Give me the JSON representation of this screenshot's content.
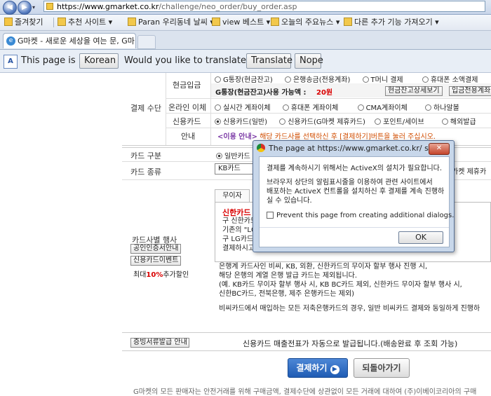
{
  "browser": {
    "url_host": "https://www.gmarket.co.kr",
    "url_path": "/challenge/neo_order/buy_order.asp",
    "favorites": [
      {
        "label": "즐겨찾기"
      },
      {
        "label": "추천 사이트 ▾"
      },
      {
        "label": "Paran 우리동네 날씨 ▾"
      },
      {
        "label": "view 베스트 ▾"
      },
      {
        "label": "오늘의 주요뉴스 ▾"
      },
      {
        "label": "다른 추가 기능 가져오기 ▾"
      }
    ],
    "tab_title": "G마켓 - 새로운 세상을 여는 문, G마켓",
    "translate": {
      "prefix": "This page is in",
      "language": "Korean",
      "question": "Would you like to translate it?",
      "translate_btn": "Translate",
      "nope_btn": "Nope"
    }
  },
  "payment": {
    "section_label": "결제 수단",
    "rows": [
      {
        "label": "현금입금",
        "options": [
          "G통장(현금잔고)",
          "은행송금(전용계좌)",
          "T머니 결제",
          "휴대폰 소액결제"
        ]
      },
      {
        "label": "온라인 이체",
        "options": [
          "실시간 계좌이체",
          "휴대폰 계좌이체",
          "CMA계좌이체",
          "하나알볼"
        ]
      },
      {
        "label": "신용카드",
        "options": [
          "신용카드(일반)",
          "신용카드(G마켓 제휴카드)",
          "포인트/세이브",
          "해외발급"
        ]
      }
    ],
    "gbank_text": "G통장(현금잔고)사용 가능액 : ",
    "gbank_amount": "20원",
    "view_balance_btn": "현금잔고상세보기",
    "deposit_btn": "입금전용계좌",
    "guide_label": "안내",
    "guide_tag": "<이용 안내>",
    "guide_text": " 해당 카드사를 선택하신 후 [결제하기]버튼을 눌러 주십시오."
  },
  "card": {
    "type_label": "카드 구분",
    "type_option": "일반카드",
    "kind_label": "카드 종류",
    "kind_value": "KB카드",
    "kind_right": "가켓 제휴카",
    "event_label": "카드사별 행사",
    "event_btn1": "공인인증서안내",
    "event_btn2": "신용카드이벤트",
    "event_max": "최대",
    "event_pct": "10%",
    "event_tail": "추가할인",
    "tab_label": "무이자",
    "promo_title": "신한카드",
    "promo_lines": [
      "구 신한카드",
      "기존의 \"LG",
      "구 LG카드",
      "결제하시고"
    ],
    "info_lines": [
      "은행계 카드사인 비씨, KB, 외환, 신한카드의 무이자 할부 행사 진행 시,",
      "해당 은행의 계열 은행 발급 카드는 제외됩니다.",
      "(예. KB카드 무이자 할부 행사 시, KB BC카드 제외, 신한카드 무이자 할부 행사 시,",
      "신한BC카드, 전북은행, 제주 은행카드는 제외)"
    ],
    "info_last": "비씨카드에서 매입하는 모든 저축은행카드의 경우, 일반 비씨카드 결제와 동일하게 진행하"
  },
  "receipt": {
    "btn": "증빙서류발급 안내",
    "text": "신용카드 매출전표가 자동으로 발급됩니다.(배송완료 후 조회 가능)"
  },
  "actions": {
    "pay_btn": "결제하기",
    "back_btn": "되돌아가기"
  },
  "footer_text": "G마켓의 모든 판매자는 안전거래를 위해 구매금액, 결제수단에 상관없이 모든 거래에 대하여 (주)이베이코리아의 구매",
  "dialog": {
    "title": "The page at https://www.gmarket.co.kr/ says:",
    "close": "✕",
    "line1": "결제를 계속하시기 위해서는 ActiveX의 설치가 필요합니다.",
    "line2": "브라우저 상단의 알림표시줄을 이용하여 관련 사이트에서",
    "line3": "배포하는 ActiveX 컨트롤을 설치하신 후 결제를 계속 진행하",
    "line4": "실 수 있습니다.",
    "checkbox_label": "Prevent this page from creating additional dialogs.",
    "ok": "OK"
  }
}
